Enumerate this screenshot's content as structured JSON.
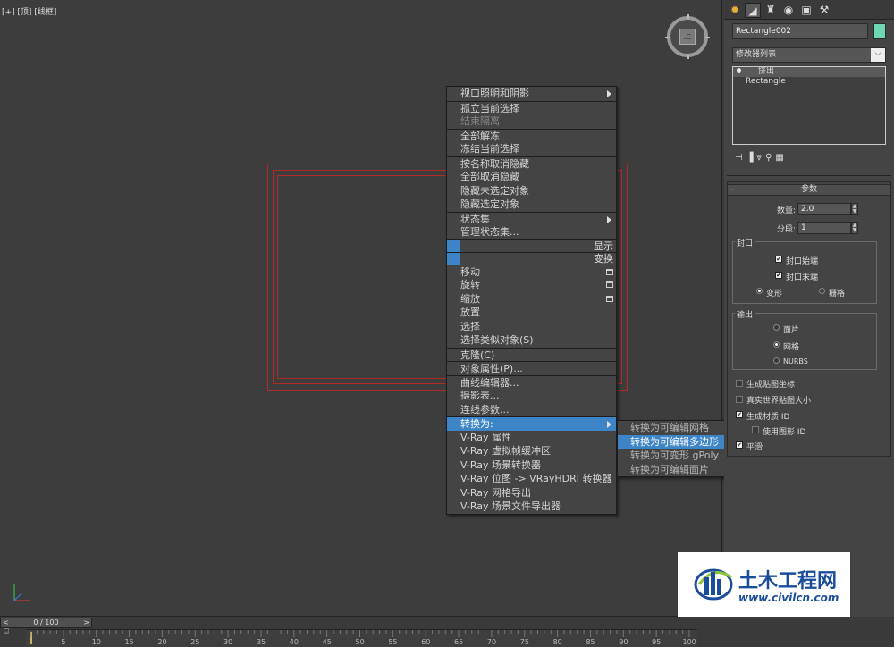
{
  "viewport": {
    "label": "[+] [顶] [线框]",
    "viewcube_face": "上"
  },
  "context_menu": {
    "items": [
      {
        "label": "视口照明和阴影",
        "disabled": false,
        "submenu": true
      },
      {
        "label": "孤立当前选择",
        "disabled": false
      },
      {
        "label": "结束隔离",
        "disabled": true
      },
      {
        "label": "全部解冻",
        "disabled": false
      },
      {
        "label": "冻结当前选择",
        "disabled": false
      },
      {
        "label": "按名称取消隐藏",
        "disabled": false
      },
      {
        "label": "全部取消隐藏",
        "disabled": false
      },
      {
        "label": "隐藏未选定对象",
        "disabled": false
      },
      {
        "label": "隐藏选定对象",
        "disabled": false
      },
      {
        "label": "状态集",
        "disabled": false,
        "submenu": true
      },
      {
        "label": "管理状态集...",
        "disabled": false
      },
      {
        "label": "显示",
        "header": true
      },
      {
        "label": "变换",
        "header": true
      },
      {
        "label": "移动",
        "disabled": false
      },
      {
        "label": "旋转",
        "disabled": false
      },
      {
        "label": "缩放",
        "disabled": false
      },
      {
        "label": "放置",
        "disabled": false
      },
      {
        "label": "选择",
        "disabled": false
      },
      {
        "label": "选择类似对象(S)",
        "disabled": false
      },
      {
        "label": "克隆(C)",
        "disabled": false
      },
      {
        "label": "对象属性(P)...",
        "disabled": false
      },
      {
        "label": "曲线编辑器...",
        "disabled": false
      },
      {
        "label": "摄影表...",
        "disabled": false
      },
      {
        "label": "连线参数...",
        "disabled": false
      },
      {
        "label": "转换为:",
        "disabled": false,
        "submenu": true,
        "highlighted": true
      },
      {
        "label": "V-Ray 属性",
        "disabled": false
      },
      {
        "label": "V-Ray 虚拟帧缓冲区",
        "disabled": false
      },
      {
        "label": "V-Ray 场景转换器",
        "disabled": false
      },
      {
        "label": "V-Ray 位图 -> VRayHDRI 转换器",
        "disabled": false
      },
      {
        "label": "V-Ray 网格导出",
        "disabled": false
      },
      {
        "label": "V-Ray 场景文件导出器",
        "disabled": false
      }
    ]
  },
  "convert_submenu": {
    "items": [
      {
        "label": "转换为可编辑网格",
        "highlighted": false
      },
      {
        "label": "转换为可编辑多边形",
        "highlighted": true
      },
      {
        "label": "转换为可变形 gPoly",
        "highlighted": false
      },
      {
        "label": "转换为可编辑面片",
        "highlighted": false
      }
    ]
  },
  "command_panel": {
    "object_name": "Rectangle002",
    "object_color": "#6dd6b4",
    "modifier_list": "修改器列表",
    "stack": [
      "挤出",
      "Rectangle"
    ],
    "rollout_title": "参数",
    "amount_label": "数量:",
    "amount_value": "2.0",
    "segments_label": "分段:",
    "segments_value": "1",
    "capping": {
      "title": "封口",
      "cap_start": "封口始端",
      "cap_end": "封口末端",
      "morph": "变形",
      "grid": "栅格"
    },
    "output": {
      "title": "输出",
      "patch": "面片",
      "mesh": "网格",
      "nurbs": "NURBS"
    },
    "gen_map_coords": "生成贴图坐标",
    "real_world_map": "真实世界贴图大小",
    "gen_mat_ids": "生成材质 ID",
    "use_shape_ids": "使用图形 ID",
    "smooth": "平滑"
  },
  "timeline": {
    "slider_value": "0 / 100",
    "slider_left": "<",
    "slider_right": ">",
    "ticks": [
      "5",
      "10",
      "15",
      "20",
      "25",
      "30",
      "35",
      "40",
      "45",
      "50",
      "55",
      "60",
      "65",
      "70",
      "75",
      "80",
      "85",
      "90",
      "95",
      "100"
    ]
  },
  "watermark": {
    "title": "土木工程网",
    "url": "www.civilcn.com"
  }
}
